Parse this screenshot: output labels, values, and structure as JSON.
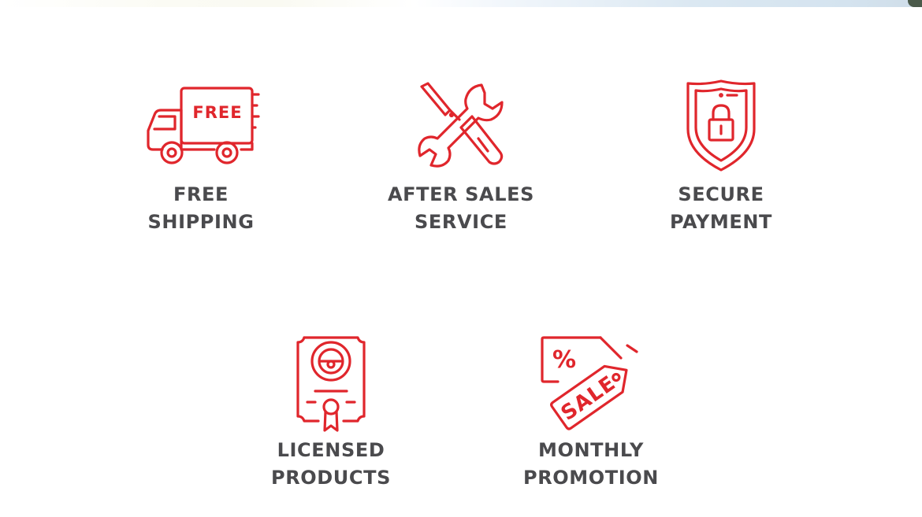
{
  "features": [
    {
      "icon": "delivery-truck-icon",
      "badge": "FREE",
      "line1": "FREE",
      "line2": "SHIPPING"
    },
    {
      "icon": "wrench-screwdriver-icon",
      "line1": "AFTER SALES",
      "line2": "SERVICE"
    },
    {
      "icon": "shield-lock-icon",
      "line1": "SECURE",
      "line2": "PAYMENT"
    },
    {
      "icon": "certificate-icon",
      "line1": "LICENSED",
      "line2": "PRODUCTS"
    },
    {
      "icon": "sale-tag-icon",
      "badge": "SALE",
      "tag_symbol": "%",
      "line1": "MONTHLY",
      "line2": "PROMOTION"
    }
  ],
  "colors": {
    "icon": "#e0262c",
    "label": "#4a4a4d",
    "background": "#ffffff"
  }
}
